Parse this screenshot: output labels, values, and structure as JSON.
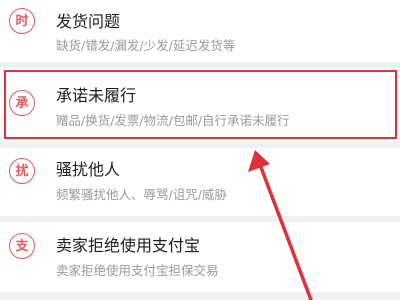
{
  "complaint_list": {
    "items": [
      {
        "badge": "时",
        "title": "发货问题",
        "desc": "缺货/错发/漏发/少发/延迟发货等"
      },
      {
        "badge": "承",
        "title": "承诺未履行",
        "desc": "赠品/换货/发票/物流/包邮/自行承诺未履行"
      },
      {
        "badge": "扰",
        "title": "骚扰他人",
        "desc": "频繁骚扰他人、辱骂/诅咒/威胁"
      },
      {
        "badge": "支",
        "title": "卖家拒绝使用支付宝",
        "desc": "卖家拒绝使用支付宝担保交易"
      }
    ]
  },
  "annotation": {
    "color": "#e0313a"
  }
}
